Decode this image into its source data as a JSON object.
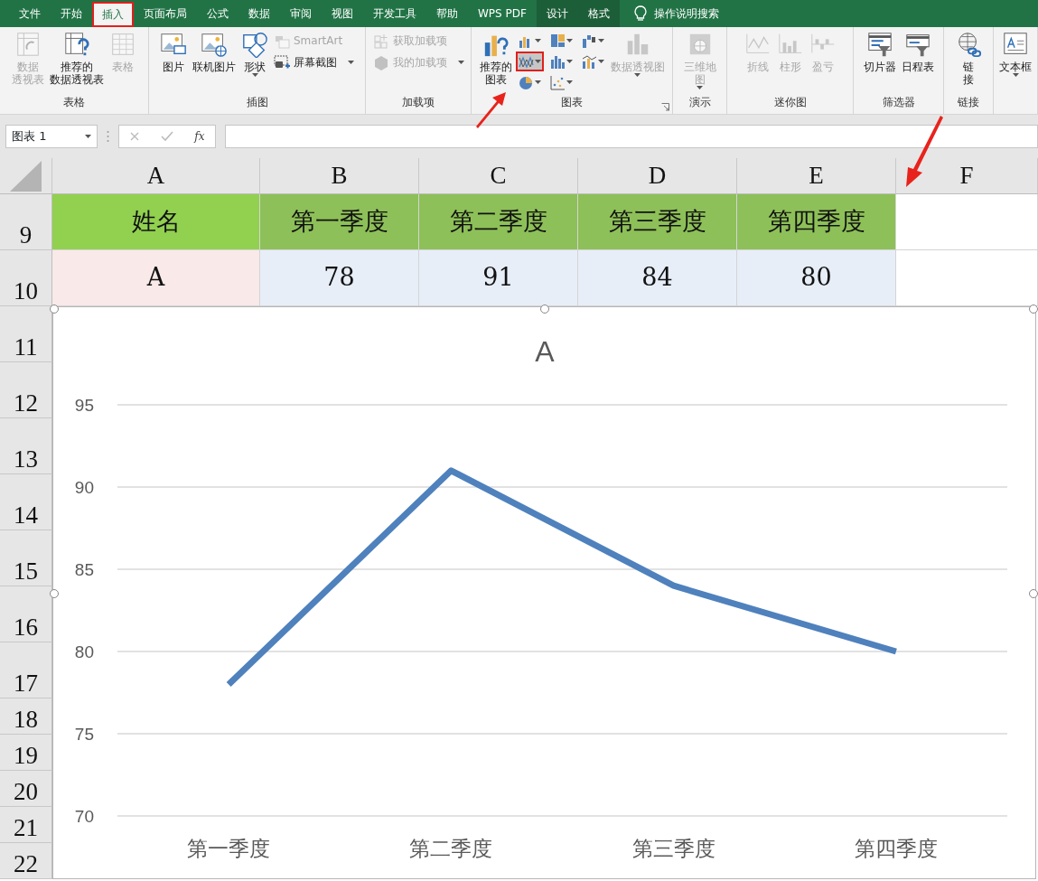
{
  "ribbon_tabs": [
    {
      "label": "文件",
      "selected": false,
      "kind": "normal"
    },
    {
      "label": "开始",
      "selected": false,
      "kind": "normal"
    },
    {
      "label": "插入",
      "selected": true,
      "kind": "normal"
    },
    {
      "label": "页面布局",
      "selected": false,
      "kind": "normal"
    },
    {
      "label": "公式",
      "selected": false,
      "kind": "normal"
    },
    {
      "label": "数据",
      "selected": false,
      "kind": "normal"
    },
    {
      "label": "审阅",
      "selected": false,
      "kind": "normal"
    },
    {
      "label": "视图",
      "selected": false,
      "kind": "normal"
    },
    {
      "label": "开发工具",
      "selected": false,
      "kind": "normal"
    },
    {
      "label": "帮助",
      "selected": false,
      "kind": "normal"
    },
    {
      "label": "WPS PDF",
      "selected": false,
      "kind": "normal"
    },
    {
      "label": "设计",
      "selected": false,
      "kind": "contextual"
    },
    {
      "label": "格式",
      "selected": false,
      "kind": "contextual"
    }
  ],
  "tell_me": {
    "label": "操作说明搜索"
  },
  "ribbon_groups": [
    {
      "label": "表格",
      "items": [
        {
          "kind": "large",
          "lines": [
            "数据",
            "透视表"
          ],
          "disabled": true
        },
        {
          "kind": "large",
          "lines": [
            "推荐的",
            "数据透视表"
          ],
          "disabled": false
        },
        {
          "kind": "large",
          "lines": [
            "表格"
          ],
          "disabled": true
        }
      ]
    },
    {
      "label": "插图",
      "items": [
        {
          "kind": "large",
          "lines": [
            "图片"
          ],
          "disabled": false
        },
        {
          "kind": "large",
          "lines": [
            "联机图片"
          ],
          "disabled": false
        },
        {
          "kind": "large",
          "lines": [
            "形状"
          ],
          "disabled": false,
          "dropdown": true
        },
        {
          "kind": "small",
          "lines": [
            "SmartArt"
          ],
          "disabled": true
        },
        {
          "kind": "small",
          "lines": [
            "屏幕截图"
          ],
          "disabled": false,
          "dropdown": true
        }
      ]
    },
    {
      "label": "加载项",
      "items": [
        {
          "kind": "small",
          "lines": [
            "获取加载项"
          ],
          "disabled": true
        },
        {
          "kind": "small",
          "lines": [
            "我的加载项"
          ],
          "disabled": true,
          "dropdown": true
        }
      ]
    },
    {
      "label": "图表",
      "launcher": true,
      "items": [
        {
          "kind": "large",
          "lines": [
            "推荐的",
            "图表"
          ],
          "disabled": false
        },
        {
          "kind": "chart_type",
          "selected": false
        },
        {
          "kind": "chart_type",
          "selected": true
        },
        {
          "kind": "chart_type",
          "selected": false
        },
        {
          "kind": "chart_type",
          "selected": false
        },
        {
          "kind": "chart_type",
          "selected": false
        },
        {
          "kind": "chart_type",
          "selected": false
        },
        {
          "kind": "chart_type",
          "selected": false
        },
        {
          "kind": "chart_type",
          "selected": false
        },
        {
          "kind": "large",
          "lines": [
            "数据透视图"
          ],
          "disabled": true,
          "dropdown": true
        }
      ]
    },
    {
      "label": "演示",
      "items": [
        {
          "kind": "large",
          "lines": [
            "三维地",
            "图"
          ],
          "disabled": true,
          "dropdown": true
        }
      ]
    },
    {
      "label": "迷你图",
      "items": [
        {
          "kind": "large",
          "lines": [
            "折线"
          ],
          "disabled": true
        },
        {
          "kind": "large",
          "lines": [
            "柱形"
          ],
          "disabled": true
        },
        {
          "kind": "large",
          "lines": [
            "盈亏"
          ],
          "disabled": true
        }
      ]
    },
    {
      "label": "筛选器",
      "items": [
        {
          "kind": "large",
          "lines": [
            "切片器"
          ],
          "disabled": false
        },
        {
          "kind": "large",
          "lines": [
            "日程表"
          ],
          "disabled": false
        }
      ]
    },
    {
      "label": "链接",
      "items": [
        {
          "kind": "large",
          "lines": [
            "链",
            "接"
          ],
          "disabled": false
        }
      ]
    },
    {
      "items": [
        {
          "kind": "large",
          "lines": [
            "文本框"
          ],
          "disabled": false,
          "dropdown": true
        }
      ]
    }
  ],
  "formula_bar": {
    "name_box": "图表 1",
    "fx": "fx"
  },
  "sheet": {
    "columns": [
      "A",
      "B",
      "C",
      "D",
      "E",
      "F"
    ],
    "rows": [
      {
        "number": "9",
        "cells": [
          "姓名",
          "第一季度",
          "第二季度",
          "第三季度",
          "第四季度"
        ]
      },
      {
        "number": "10",
        "cells": [
          "A",
          "78",
          "91",
          "84",
          "80"
        ]
      },
      {
        "number": "11"
      },
      {
        "number": "12"
      },
      {
        "number": "13"
      },
      {
        "number": "14"
      },
      {
        "number": "15"
      },
      {
        "number": "16"
      },
      {
        "number": "17"
      },
      {
        "number": "18"
      },
      {
        "number": "19"
      },
      {
        "number": "20"
      },
      {
        "number": "21"
      },
      {
        "number": "22"
      }
    ]
  },
  "chart": {
    "chart_data": {
      "type": "line",
      "title": "A",
      "categories": [
        "第一季度",
        "第二季度",
        "第三季度",
        "第四季度"
      ],
      "series": [
        {
          "color": "#4f81bd",
          "values": [
            78,
            91,
            84,
            80
          ]
        }
      ],
      "ylim": [
        70,
        95
      ],
      "yticks": [
        70,
        75,
        80,
        85,
        90,
        95
      ],
      "grid": true
    }
  }
}
